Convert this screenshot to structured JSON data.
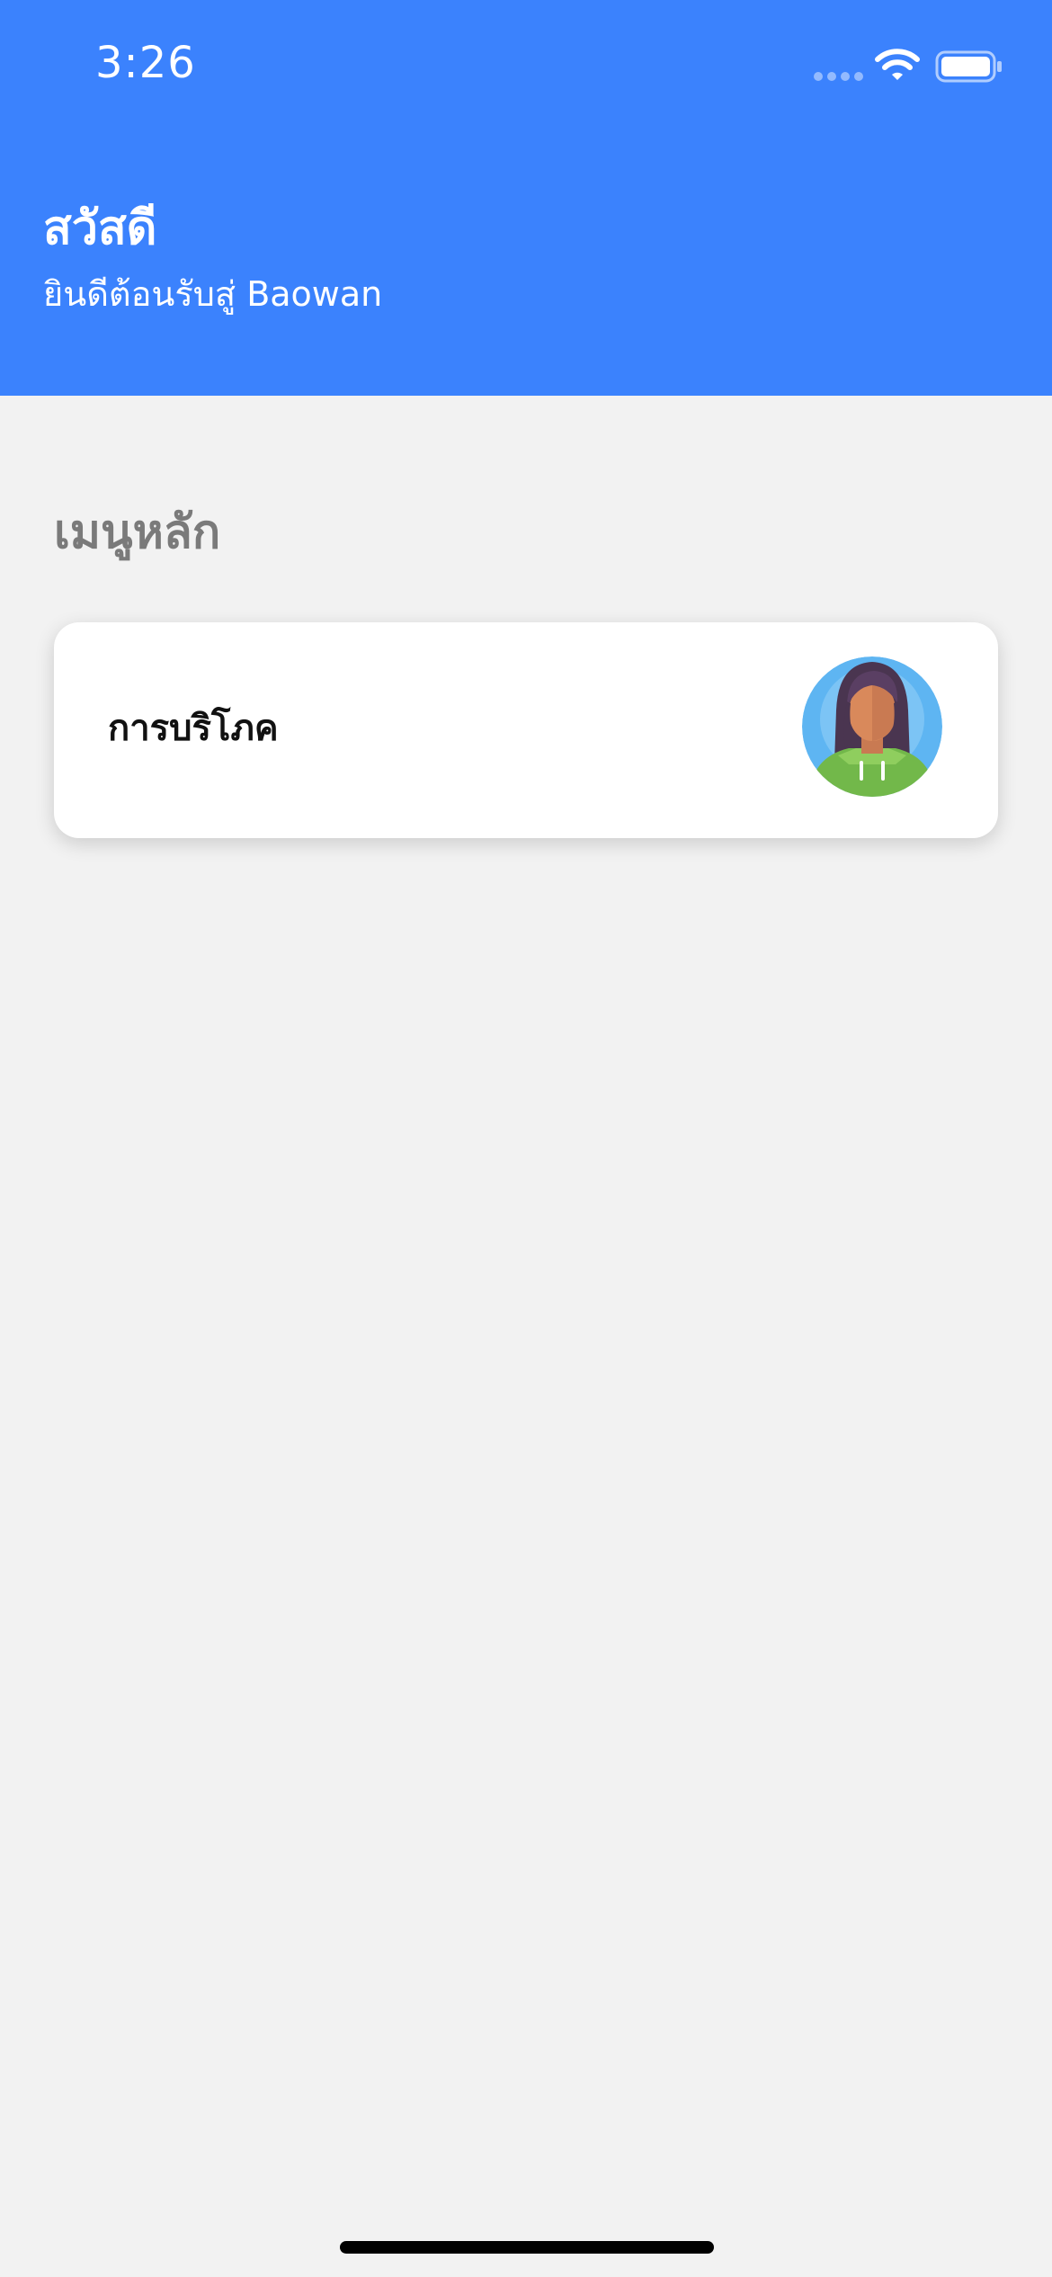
{
  "status_bar": {
    "time": "3:26",
    "signal_icon": "cellular-signal-icon",
    "wifi_icon": "wifi-icon",
    "battery_icon": "battery-icon"
  },
  "header": {
    "greeting": "สวัสดี",
    "welcome": "ยินดีต้อนรับสู่ Baowan",
    "background_color": "#3b82fd"
  },
  "main": {
    "section_title": "เมนูหลัก",
    "menu_items": [
      {
        "label": "การบริโภค",
        "icon": "person-avatar-icon"
      }
    ]
  },
  "colors": {
    "accent": "#3b82fd",
    "page_background": "#f2f2f2",
    "card_background": "#ffffff",
    "section_title": "#7a7a7a"
  }
}
